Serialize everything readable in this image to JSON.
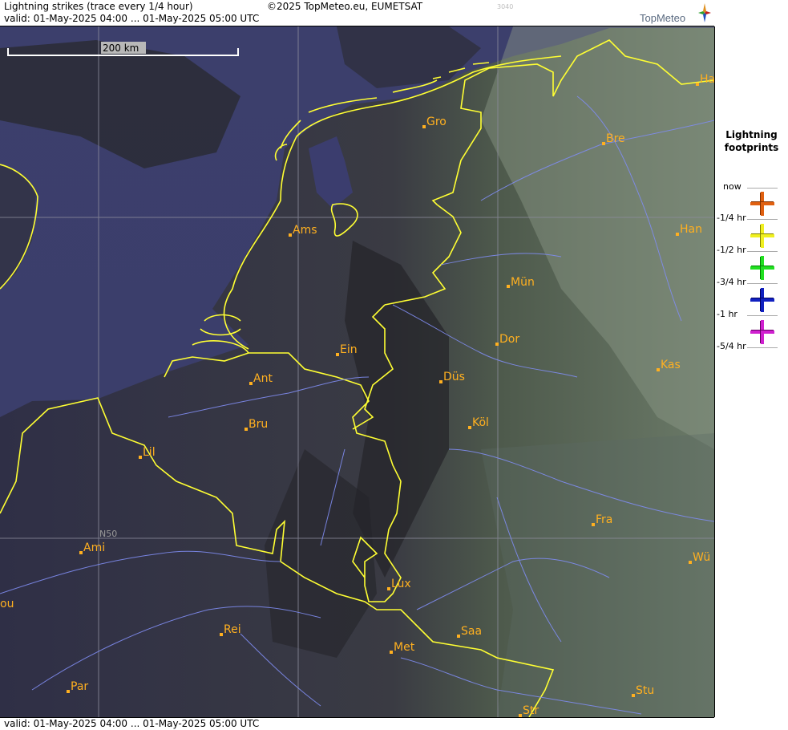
{
  "header": {
    "title": "Lightning strikes (trace every 1/4 hour)",
    "copyright": "©2025 TopMeteo.eu, EUMETSAT",
    "code": "3040",
    "valid": "valid:  01-May-2025 04:00 ... 01-May-2025 05:00 UTC",
    "logo": "TopMeteo"
  },
  "footer": {
    "valid": "valid:  01-May-2025 04:00 ... 01-May-2025 05:00 UTC"
  },
  "map": {
    "scale_label": "200 km",
    "grid_label": "N50",
    "cities": [
      "Ha",
      "Gro",
      "Bre",
      "Ams",
      "Han",
      "Mün",
      "Dor",
      "Ein",
      "Kas",
      "Ant",
      "Düs",
      "Köl",
      "Bru",
      "Lil",
      "Fra",
      "Ami",
      "Wü",
      "Lux",
      "ou",
      "Rei",
      "Saa",
      "Met",
      "Stu",
      "Par",
      "Str"
    ]
  },
  "legend": {
    "title_line1": "Lightning",
    "title_line2": "footprints",
    "items": [
      {
        "label": "now",
        "color": "#e06010"
      },
      {
        "label": "-1/4 hr",
        "color": "#f0f020"
      },
      {
        "label": "-1/2 hr",
        "color": "#20e020"
      },
      {
        "label": "-3/4 hr",
        "color": "#1020c0"
      },
      {
        "label": "-1 hr",
        "color": "#d020d0"
      },
      {
        "label": "-5/4 hr",
        "color": ""
      }
    ]
  },
  "colors": {
    "land_dark": "#26263e",
    "sea": "#3b3d6e",
    "border": "#ffff33",
    "river": "#7f8cf0",
    "city": "#ffb020"
  }
}
